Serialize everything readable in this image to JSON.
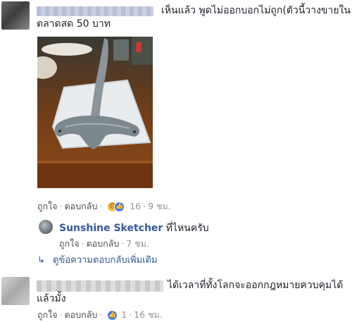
{
  "comment1": {
    "text_line1": "เห็นแล้ว พูดไม่ออกบอกไม่ถูก(ตัวนี้วางขายใน",
    "text_line2": "ตลาดสด 50 บาท",
    "actions": {
      "like": "ถูกใจ",
      "reply": "ตอบกลับ",
      "reaction_count": "16",
      "time": "9 ชม."
    }
  },
  "reply1": {
    "author": "Sunshine Sketcher",
    "text": "ที่ไหนครับ",
    "actions": {
      "like": "ถูกใจ",
      "reply": "ตอบกลับ",
      "time": "7 ชม."
    }
  },
  "more_replies": "ดูข้อความตอบกลับเพิ่มเติม",
  "comment2": {
    "text_line1": "ได้เวลาที่ทั้งโลกจะออกกฎหมายควบคุมได้",
    "text_line2": "แล้วมั้ง",
    "actions": {
      "like": "ถูกใจ",
      "reply": "ตอบกลับ",
      "reaction_count": "1",
      "time": "16 ชม."
    }
  },
  "icons": {
    "reactions_c1": [
      "sad-reaction-icon",
      "like-reaction-icon"
    ],
    "reactions_c2": [
      "like-reaction-icon"
    ],
    "reply_arrow": "reply-arrow-icon"
  },
  "colors": {
    "link_blue": "#365899",
    "meta_gray": "#90949c",
    "like_blue": "#4a7cf7"
  }
}
